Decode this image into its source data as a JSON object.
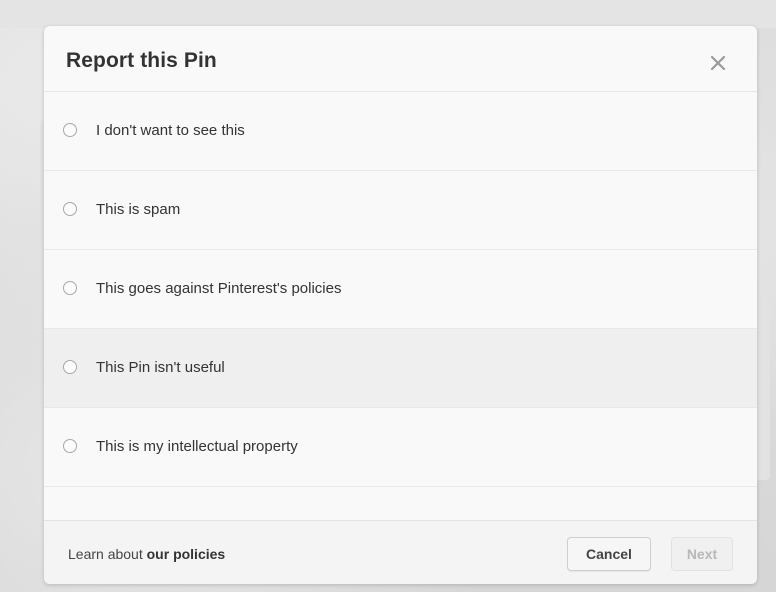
{
  "modal": {
    "title": "Report this Pin",
    "close_icon": "close-icon"
  },
  "options": [
    {
      "label": "I don't want to see this",
      "selected": false
    },
    {
      "label": "This is spam",
      "selected": false
    },
    {
      "label": "This goes against Pinterest's policies",
      "selected": false
    },
    {
      "label": "This Pin isn't useful",
      "selected": false,
      "hovered": true
    },
    {
      "label": "This is my intellectual property",
      "selected": false
    }
  ],
  "footer": {
    "learn_prefix": "Learn about ",
    "learn_link": "our policies",
    "cancel_label": "Cancel",
    "next_label": "Next",
    "next_disabled": true
  },
  "colors": {
    "modal_bg": "#f9f9f9",
    "hover_row": "#efefef",
    "text": "#333333",
    "disabled_text": "#b8b8b8"
  }
}
